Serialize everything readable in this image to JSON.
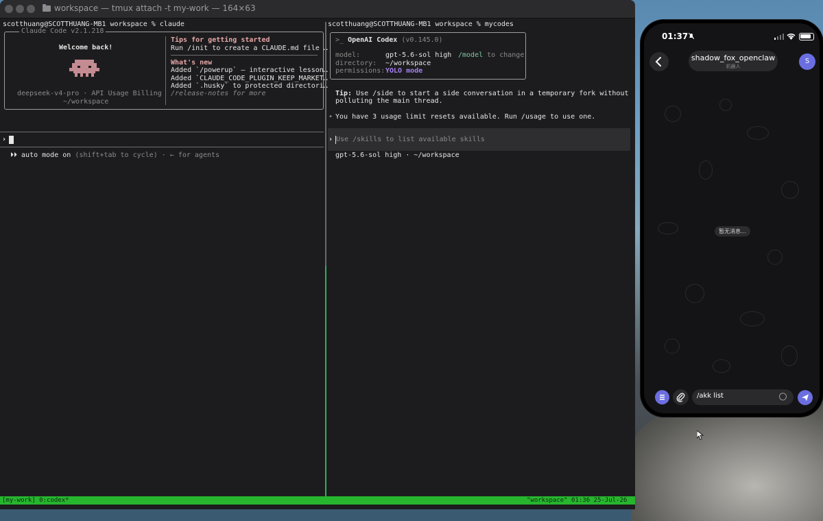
{
  "window": {
    "title": "workspace — tmux attach -t my-work — 164×63"
  },
  "left_pane": {
    "prompt_line": "scotthuang@SCOTTHUANG-MB1 workspace % claude",
    "box_title": "Claude Code v2.1.218",
    "welcome": "Welcome back!",
    "account": "deepseek-v4-pro · API Usage Billing",
    "cwd": "~/workspace",
    "tips_heading": "Tips for getting started",
    "tips_line": "Run /init to create a CLAUDE.md file …",
    "whats_new_heading": "What's new",
    "whats_new": [
      "Added `/powerup` — interactive lesson…",
      "Added `CLAUDE_CODE_PLUGIN_KEEP_MARKET…",
      "Added `.husky` to protected directori…"
    ],
    "release_notes": "/release-notes for more",
    "input_prompt": "›",
    "mode_icon": "⏵⏵",
    "mode_label": "auto mode on",
    "mode_hint": "(shift+tab to cycle) · ← for agents"
  },
  "right_pane": {
    "prompt_line": "scotthuang@SCOTTHUANG-MB1 workspace % mycodes",
    "codex_name": "OpenAI Codex",
    "codex_version": "(v0.145.0)",
    "codex_prefix": ">_",
    "model_key": "model:",
    "model_value": "gpt-5.6-sol high",
    "model_hint_cmd": "/model",
    "model_hint_text": "to change",
    "directory_key": "directory:",
    "directory_value": "~/workspace",
    "permissions_key": "permissions:",
    "permissions_value": "YOLO mode",
    "tip_label": "Tip:",
    "tip_line1": "Use /side to start a side conversation in a temporary fork without",
    "tip_line2": "polluting the main thread.",
    "bullet": "•",
    "usage_line": "You have 3 usage limit resets available. Run /usage to use one.",
    "input_prompt": "›",
    "input_placeholder": "Use /skills to list available skills",
    "footer": "gpt-5.6-sol high · ~/workspace"
  },
  "status_bar": {
    "left": "[my-work] 0:codex*",
    "right": "\"workspace\" 01:36 25-Jul-26"
  },
  "phone": {
    "time": "01:37",
    "chat_title": "shadow_fox_openclaw",
    "chat_subtitle": "机器人",
    "avatar_letter": "S",
    "empty_text": "暂无消息...",
    "input_value": "/akk list",
    "accent": "#6b6ee0"
  }
}
